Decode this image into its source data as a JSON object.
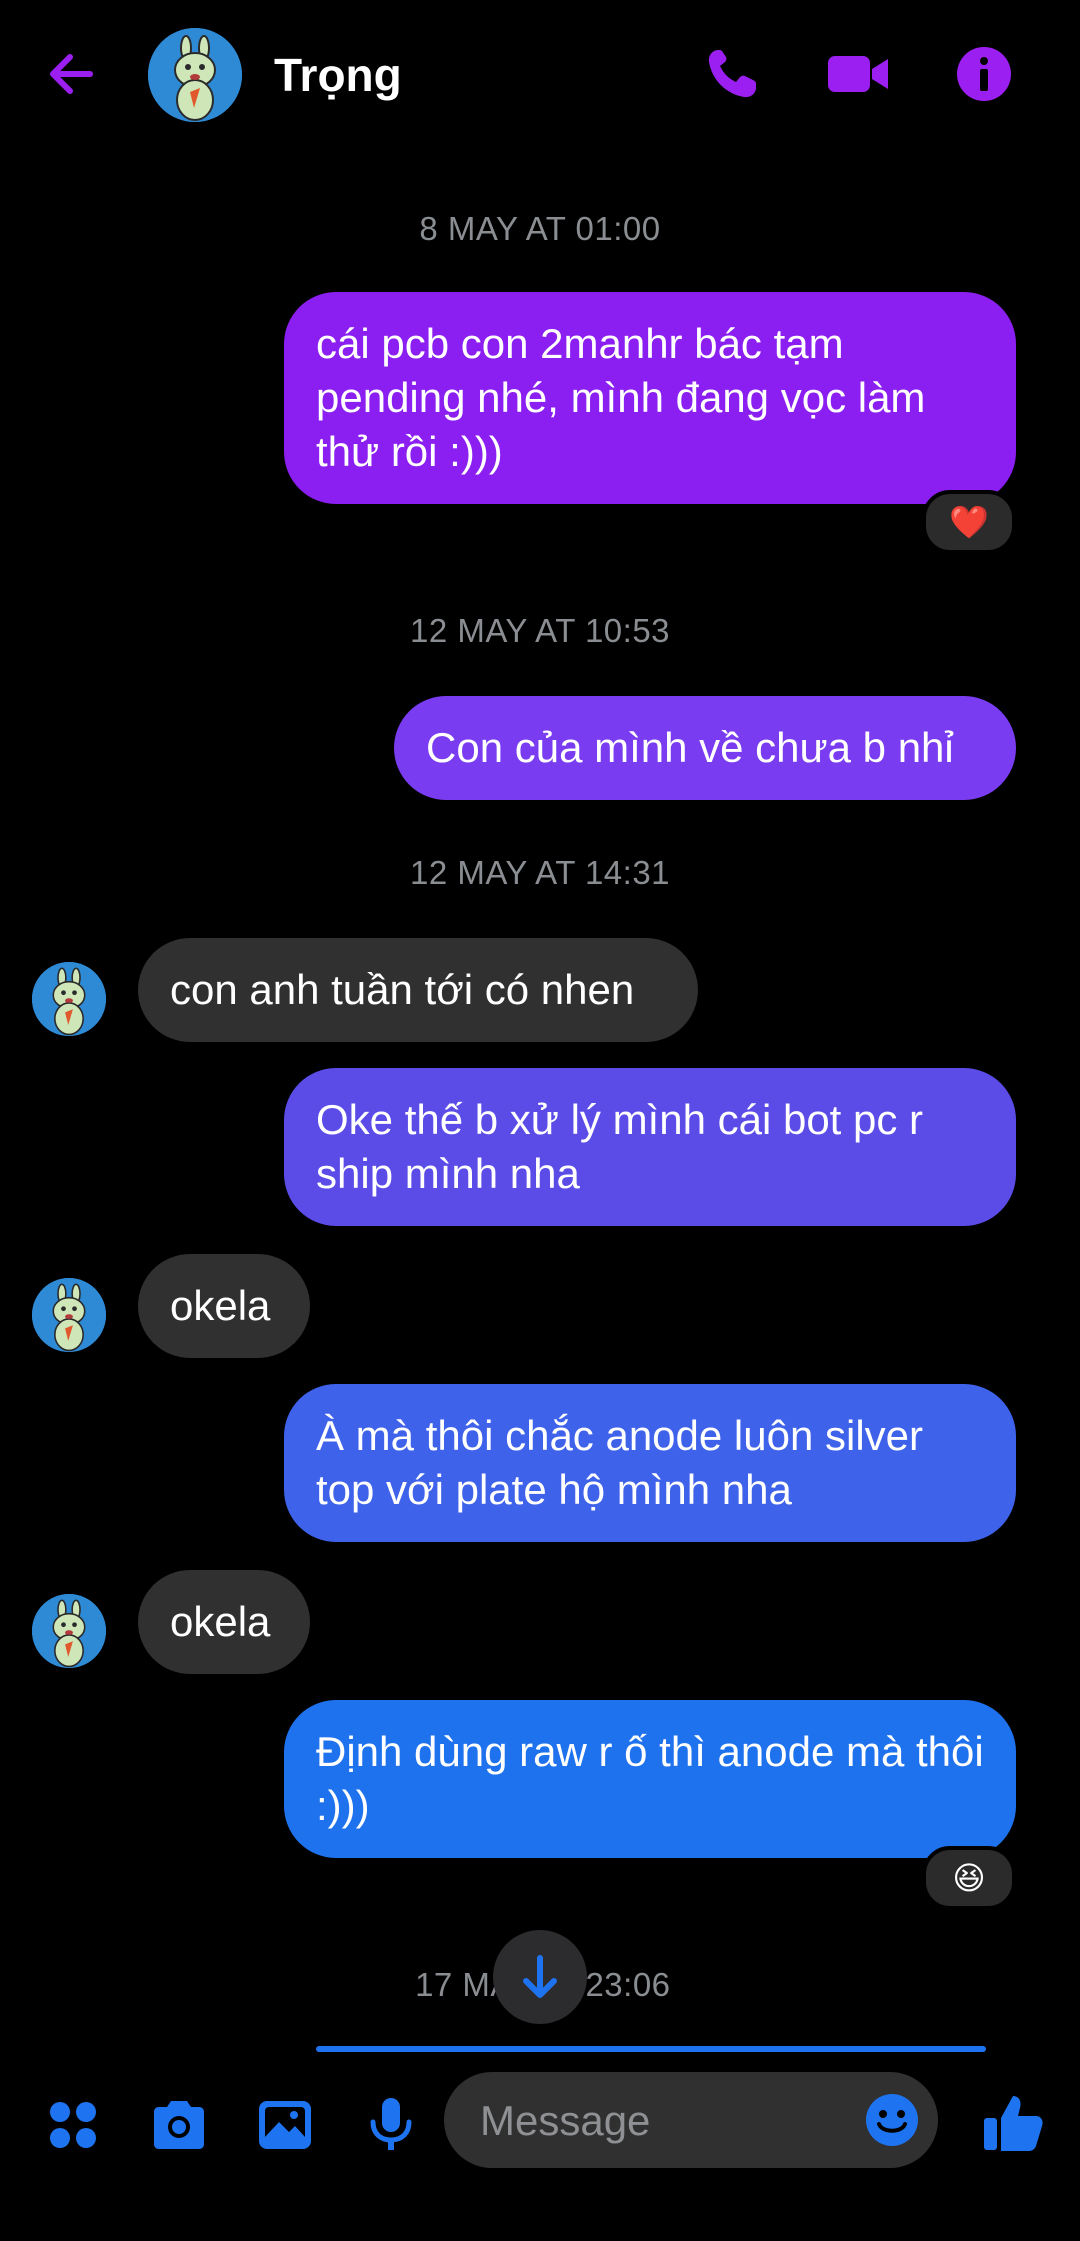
{
  "header": {
    "contact_name": "Trọng",
    "icons": [
      "back-arrow-icon",
      "phone-icon",
      "video-camera-icon",
      "info-icon"
    ],
    "accent_color": "#9b1ff0"
  },
  "timestamps": {
    "t1": "8 MAY AT 01:00",
    "t2": "12 MAY AT 10:53",
    "t3": "12 MAY AT 14:31",
    "t4_left": "17 MA",
    "t4_right": "23:06"
  },
  "messages": {
    "m1": "cái pcb con 2manhr bác tạm pending nhé, mình đang vọc làm thử rồi :)))",
    "m1_reaction": "❤️",
    "m2": "Con của mình về chưa b nhỉ",
    "m3": "con anh tuần tới có nhen",
    "m4": "Oke thế b xử lý mình cái bot pc r ship mình nha",
    "m5": "okela",
    "m6": "À mà thôi chắc anode luôn silver top với plate hộ mình nha",
    "m7": "okela",
    "m8": "Định dùng raw r ố thì anode mà thôi :)))",
    "m8_reaction": "😆"
  },
  "composer": {
    "placeholder": "Message",
    "icons": [
      "apps-icon",
      "camera-icon",
      "gallery-icon",
      "microphone-icon",
      "emoji-icon",
      "thumbs-up-icon"
    ]
  },
  "colors": {
    "bubble_purple": "#8b1ef0",
    "bubble_violet": "#7a3cf0",
    "bubble_indigo": "#5b4ce8",
    "bubble_royal": "#3f62ea",
    "bubble_blue": "#1f72ee",
    "incoming_bubble": "#303030",
    "composer_icon": "#1e74f0"
  }
}
